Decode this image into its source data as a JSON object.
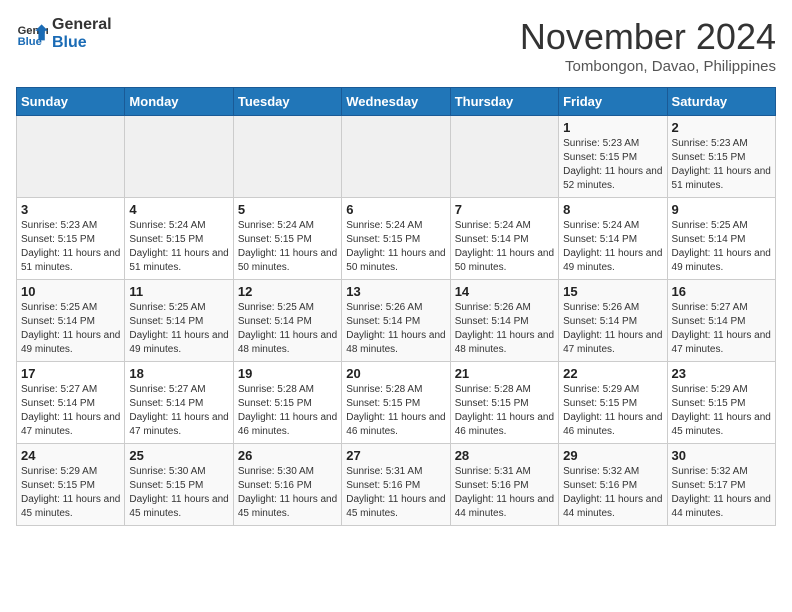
{
  "header": {
    "logo_line1": "General",
    "logo_line2": "Blue",
    "month": "November 2024",
    "location": "Tombongon, Davao, Philippines"
  },
  "weekdays": [
    "Sunday",
    "Monday",
    "Tuesday",
    "Wednesday",
    "Thursday",
    "Friday",
    "Saturday"
  ],
  "weeks": [
    [
      {
        "day": "",
        "info": ""
      },
      {
        "day": "",
        "info": ""
      },
      {
        "day": "",
        "info": ""
      },
      {
        "day": "",
        "info": ""
      },
      {
        "day": "",
        "info": ""
      },
      {
        "day": "1",
        "info": "Sunrise: 5:23 AM\nSunset: 5:15 PM\nDaylight: 11 hours and 52 minutes."
      },
      {
        "day": "2",
        "info": "Sunrise: 5:23 AM\nSunset: 5:15 PM\nDaylight: 11 hours and 51 minutes."
      }
    ],
    [
      {
        "day": "3",
        "info": "Sunrise: 5:23 AM\nSunset: 5:15 PM\nDaylight: 11 hours and 51 minutes."
      },
      {
        "day": "4",
        "info": "Sunrise: 5:24 AM\nSunset: 5:15 PM\nDaylight: 11 hours and 51 minutes."
      },
      {
        "day": "5",
        "info": "Sunrise: 5:24 AM\nSunset: 5:15 PM\nDaylight: 11 hours and 50 minutes."
      },
      {
        "day": "6",
        "info": "Sunrise: 5:24 AM\nSunset: 5:15 PM\nDaylight: 11 hours and 50 minutes."
      },
      {
        "day": "7",
        "info": "Sunrise: 5:24 AM\nSunset: 5:14 PM\nDaylight: 11 hours and 50 minutes."
      },
      {
        "day": "8",
        "info": "Sunrise: 5:24 AM\nSunset: 5:14 PM\nDaylight: 11 hours and 49 minutes."
      },
      {
        "day": "9",
        "info": "Sunrise: 5:25 AM\nSunset: 5:14 PM\nDaylight: 11 hours and 49 minutes."
      }
    ],
    [
      {
        "day": "10",
        "info": "Sunrise: 5:25 AM\nSunset: 5:14 PM\nDaylight: 11 hours and 49 minutes."
      },
      {
        "day": "11",
        "info": "Sunrise: 5:25 AM\nSunset: 5:14 PM\nDaylight: 11 hours and 49 minutes."
      },
      {
        "day": "12",
        "info": "Sunrise: 5:25 AM\nSunset: 5:14 PM\nDaylight: 11 hours and 48 minutes."
      },
      {
        "day": "13",
        "info": "Sunrise: 5:26 AM\nSunset: 5:14 PM\nDaylight: 11 hours and 48 minutes."
      },
      {
        "day": "14",
        "info": "Sunrise: 5:26 AM\nSunset: 5:14 PM\nDaylight: 11 hours and 48 minutes."
      },
      {
        "day": "15",
        "info": "Sunrise: 5:26 AM\nSunset: 5:14 PM\nDaylight: 11 hours and 47 minutes."
      },
      {
        "day": "16",
        "info": "Sunrise: 5:27 AM\nSunset: 5:14 PM\nDaylight: 11 hours and 47 minutes."
      }
    ],
    [
      {
        "day": "17",
        "info": "Sunrise: 5:27 AM\nSunset: 5:14 PM\nDaylight: 11 hours and 47 minutes."
      },
      {
        "day": "18",
        "info": "Sunrise: 5:27 AM\nSunset: 5:14 PM\nDaylight: 11 hours and 47 minutes."
      },
      {
        "day": "19",
        "info": "Sunrise: 5:28 AM\nSunset: 5:15 PM\nDaylight: 11 hours and 46 minutes."
      },
      {
        "day": "20",
        "info": "Sunrise: 5:28 AM\nSunset: 5:15 PM\nDaylight: 11 hours and 46 minutes."
      },
      {
        "day": "21",
        "info": "Sunrise: 5:28 AM\nSunset: 5:15 PM\nDaylight: 11 hours and 46 minutes."
      },
      {
        "day": "22",
        "info": "Sunrise: 5:29 AM\nSunset: 5:15 PM\nDaylight: 11 hours and 46 minutes."
      },
      {
        "day": "23",
        "info": "Sunrise: 5:29 AM\nSunset: 5:15 PM\nDaylight: 11 hours and 45 minutes."
      }
    ],
    [
      {
        "day": "24",
        "info": "Sunrise: 5:29 AM\nSunset: 5:15 PM\nDaylight: 11 hours and 45 minutes."
      },
      {
        "day": "25",
        "info": "Sunrise: 5:30 AM\nSunset: 5:15 PM\nDaylight: 11 hours and 45 minutes."
      },
      {
        "day": "26",
        "info": "Sunrise: 5:30 AM\nSunset: 5:16 PM\nDaylight: 11 hours and 45 minutes."
      },
      {
        "day": "27",
        "info": "Sunrise: 5:31 AM\nSunset: 5:16 PM\nDaylight: 11 hours and 45 minutes."
      },
      {
        "day": "28",
        "info": "Sunrise: 5:31 AM\nSunset: 5:16 PM\nDaylight: 11 hours and 44 minutes."
      },
      {
        "day": "29",
        "info": "Sunrise: 5:32 AM\nSunset: 5:16 PM\nDaylight: 11 hours and 44 minutes."
      },
      {
        "day": "30",
        "info": "Sunrise: 5:32 AM\nSunset: 5:17 PM\nDaylight: 11 hours and 44 minutes."
      }
    ]
  ]
}
